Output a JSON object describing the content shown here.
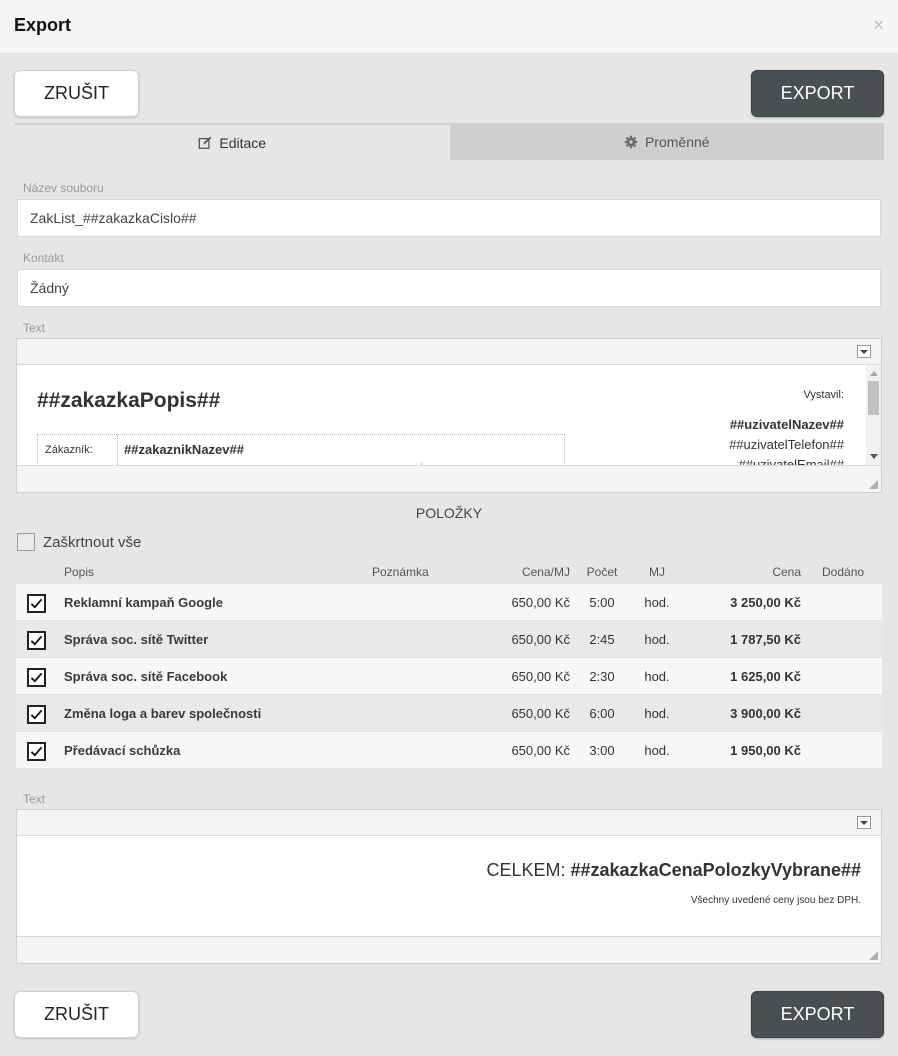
{
  "dialog": {
    "title": "Export",
    "close_label": "×"
  },
  "buttons": {
    "cancel": "ZRUŠIT",
    "export": "EXPORT"
  },
  "tabs": [
    {
      "label": "Editace",
      "active": true,
      "icon": "edit-icon"
    },
    {
      "label": "Proměnné",
      "active": false,
      "icon": "gear-icon"
    }
  ],
  "form": {
    "filename_label": "Název souboru",
    "filename_value": "ZakList_##zakazkaCislo##",
    "contact_label": "Kontakt",
    "contact_value": "Žádný",
    "text_label": "Text"
  },
  "editor1": {
    "heading": "##zakazkaPopis##",
    "issued_by_label": "Vystavil:",
    "user_name": "##uzivatelNazev##",
    "user_phone": "##uzivatelTelefon##",
    "user_email": "##uzivatelEmail##",
    "customer_label": "Zákazník:",
    "customer_value": "##zakaznikNazev##"
  },
  "items": {
    "section_title": "POLOŽKY",
    "check_all_label": "Zaškrtnout vše",
    "columns": {
      "desc": "Popis",
      "note": "Poznámka",
      "unit_price": "Cena/MJ",
      "qty": "Počet",
      "unit": "MJ",
      "price": "Cena",
      "delivered": "Dodáno"
    },
    "rows": [
      {
        "checked": true,
        "desc": "Reklamní kampaň Google",
        "note": "",
        "unit_price": "650,00 Kč",
        "qty": "5:00",
        "unit": "hod.",
        "price": "3 250,00 Kč",
        "delivered": ""
      },
      {
        "checked": true,
        "desc": "Správa soc. sítě Twitter",
        "note": "",
        "unit_price": "650,00 Kč",
        "qty": "2:45",
        "unit": "hod.",
        "price": "1 787,50 Kč",
        "delivered": ""
      },
      {
        "checked": true,
        "desc": "Správa soc. sítě Facebook",
        "note": "",
        "unit_price": "650,00 Kč",
        "qty": "2:30",
        "unit": "hod.",
        "price": "1 625,00 Kč",
        "delivered": ""
      },
      {
        "checked": true,
        "desc": "Změna loga a barev společnosti",
        "note": "",
        "unit_price": "650,00 Kč",
        "qty": "6:00",
        "unit": "hod.",
        "price": "3 900,00 Kč",
        "delivered": ""
      },
      {
        "checked": true,
        "desc": "Předávací schůzka",
        "note": "",
        "unit_price": "650,00 Kč",
        "qty": "3:00",
        "unit": "hod.",
        "price": "1 950,00 Kč",
        "delivered": ""
      }
    ]
  },
  "editor2": {
    "label": "Text",
    "total_prefix": "CELKEM: ",
    "total_value": "##zakazkaCenaPolozkyVybrane##",
    "note": "Všechny uvedené ceny jsou bez DPH."
  },
  "colors": {
    "export_button": "#4a4f52",
    "background": "#e6e6e6",
    "inactive_tab": "#cfcfcf"
  }
}
